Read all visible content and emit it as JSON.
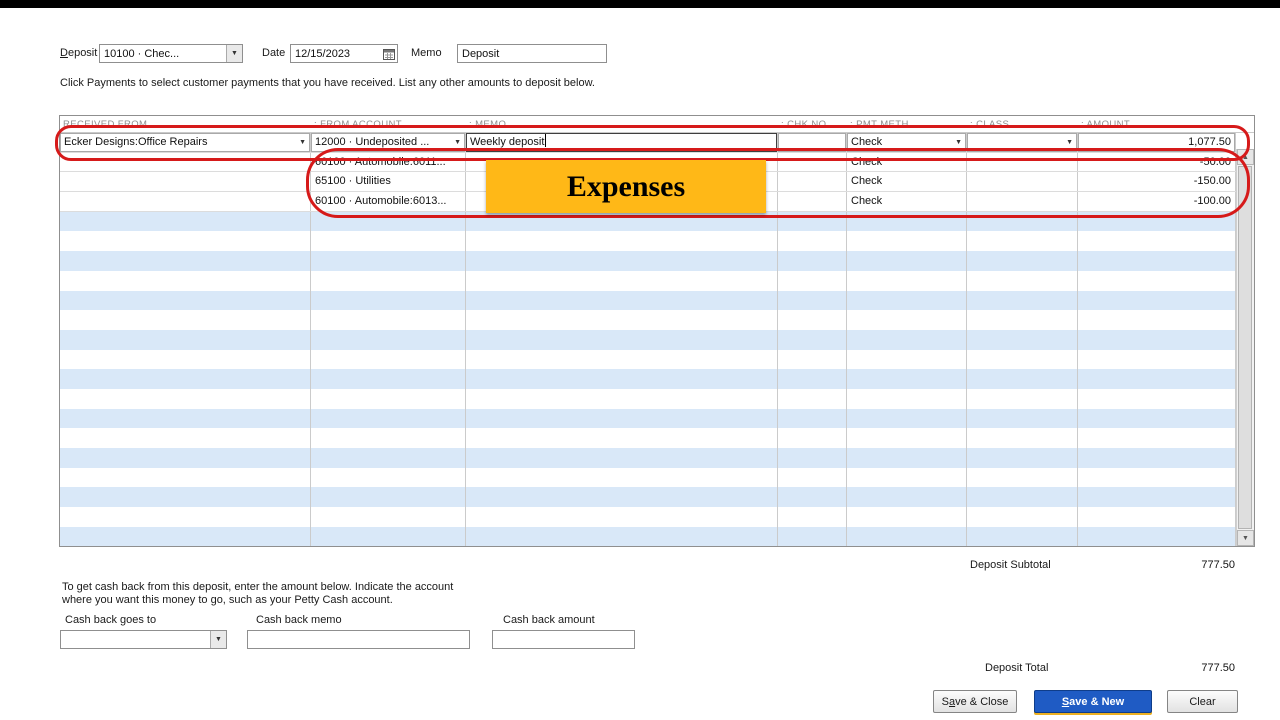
{
  "window": {
    "top_bar_color": "#000000"
  },
  "toolbar": {
    "deposit_to_label": "Deposit To",
    "deposit_to_value": "10100 · Chec...",
    "date_label": "Date",
    "date_value": "12/15/2023",
    "memo_label": "Memo",
    "memo_value": "Deposit"
  },
  "instruction": "Click Payments to select customer payments that you have received. List any other amounts to deposit below.",
  "table": {
    "headers": [
      "RECEIVED FROM",
      ": FROM ACCOUNT",
      ": MEMO",
      ": CHK NO.",
      ": PMT METH.",
      ": CLASS",
      ": AMOUNT"
    ],
    "rows": [
      {
        "received_from": "Ecker Designs:Office Repairs",
        "from_account": "12000 · Undeposited ...",
        "memo": "Weekly deposit",
        "chk_no": "",
        "pmt_meth": "Check",
        "class": "",
        "amount": "1,077.50"
      },
      {
        "received_from": "",
        "from_account": "60100 · Automobile:6011...",
        "memo": "",
        "chk_no": "",
        "pmt_meth": "Check",
        "class": "",
        "amount": "-50.00"
      },
      {
        "received_from": "",
        "from_account": "65100 · Utilities",
        "memo": "",
        "chk_no": "",
        "pmt_meth": "Check",
        "class": "",
        "amount": "-150.00"
      },
      {
        "received_from": "",
        "from_account": "60100 · Automobile:6013...",
        "memo": "",
        "chk_no": "",
        "pmt_meth": "Check",
        "class": "",
        "amount": "-100.00"
      }
    ],
    "empty_row_count": 17
  },
  "annotation": {
    "expenses_label": "Expenses",
    "box_color": "#ffb817",
    "circle_color": "#d61a1a"
  },
  "summary": {
    "subtotal_label": "Deposit Subtotal",
    "subtotal_value": "777.50",
    "total_label": "Deposit Total",
    "total_value": "777.50"
  },
  "cash_back": {
    "line1": "To get cash back from this deposit, enter the amount below.  Indicate the account",
    "line2": "where you want this money to go, such as your Petty Cash account.",
    "goes_to_label": "Cash back goes to",
    "memo_label": "Cash back memo",
    "amount_label": "Cash back amount"
  },
  "buttons": {
    "save_close": "Save & Close",
    "save_new": "Save & New",
    "save_new_bg": "#1f5bc4",
    "clear": "Clear"
  }
}
